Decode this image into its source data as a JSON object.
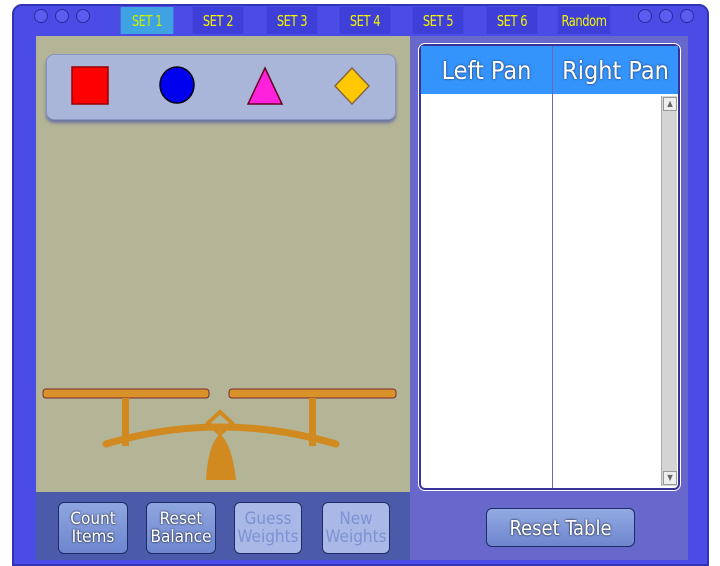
{
  "tabs": [
    {
      "label": "SET 1",
      "active": true
    },
    {
      "label": "SET 2"
    },
    {
      "label": "SET 3"
    },
    {
      "label": "SET 4"
    },
    {
      "label": "SET 5"
    },
    {
      "label": "SET 6"
    },
    {
      "label": "Random"
    }
  ],
  "palette": {
    "shapes": [
      "red-square",
      "blue-circle",
      "magenta-triangle",
      "yellow-diamond"
    ],
    "colors": {
      "square": "#ff0000",
      "circle": "#0000ee",
      "triangle": "#ff22dd",
      "diamond": "#ffc800"
    }
  },
  "buttons": {
    "count_items": "Count Items",
    "reset_balance": "Reset Balance",
    "guess_weights": "Guess Weights",
    "new_weights": "New Weights",
    "reset_table": "Reset Table"
  },
  "table": {
    "headers": [
      "Left Pan",
      "Right Pan"
    ],
    "rows": []
  },
  "colors": {
    "frame": "#4b4ce6",
    "header": "#3494fb",
    "active_tab": "#3fa2e2",
    "tab_text": "#f4f400"
  }
}
